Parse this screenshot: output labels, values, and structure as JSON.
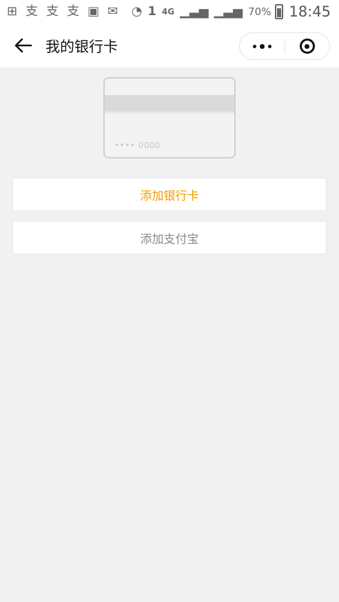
{
  "status_bar": {
    "network": "4G",
    "battery_percent": "70%",
    "time": "18:45",
    "sim_label": "1"
  },
  "nav": {
    "title": "我的银行卡"
  },
  "card": {
    "number_mask": "•••• 0000"
  },
  "actions": {
    "add_bank_card": "添加银行卡",
    "add_alipay": "添加支付宝"
  },
  "colors": {
    "accent": "#f39a00",
    "background": "#f1f1f1"
  }
}
